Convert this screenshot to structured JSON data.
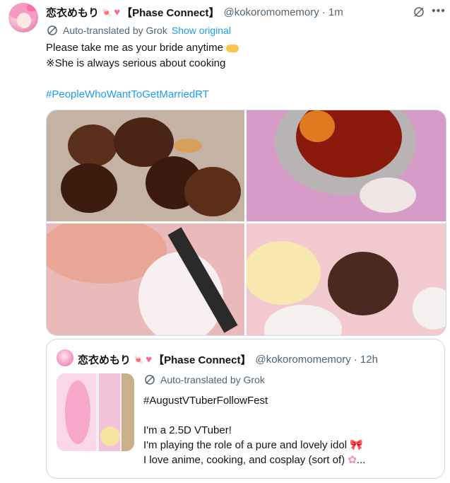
{
  "tweet": {
    "display_name": "恋衣めもり",
    "affiliation": "【Phase Connect】",
    "handle": "@kokoromomemory",
    "time": "· 1m",
    "translation_note": "Auto-translated by Grok",
    "show_original": "Show original",
    "lines": [
      "Please take me as your bride anytime",
      "※She is always serious about cooking",
      "",
      "#PeopleWhoWantToGetMarriedRT"
    ],
    "media": [
      "takoyaki-photo",
      "cooking-pan-photo",
      "fried-rice-photo",
      "batter-bowls-photo"
    ]
  },
  "quoted_tweet": {
    "display_name": "恋衣めもり",
    "affiliation": "【Phase Connect】",
    "handle": "@kokoromomemory",
    "time": "· 12h",
    "translation_note": "Auto-translated by Grok",
    "lines": [
      "#AugustVTuberFollowFest",
      "",
      "I'm a 2.5D VTuber!",
      "I'm playing the role of a pure and lovely idol",
      "I love anime, cooking, and cosplay (sort of)",
      "..."
    ]
  },
  "icons": {
    "candy": "candy-icon",
    "heart": "heart-icon",
    "mute": "mute-icon",
    "more": "more-icon",
    "translate": "translate-icon",
    "hands": "heart-hands-icon",
    "bow": "ribbon-bow-icon",
    "flower": "cherry-blossom-icon"
  },
  "colors": {
    "link": "#1d9bf0",
    "muted": "#536471",
    "heart": "#f06f89"
  }
}
